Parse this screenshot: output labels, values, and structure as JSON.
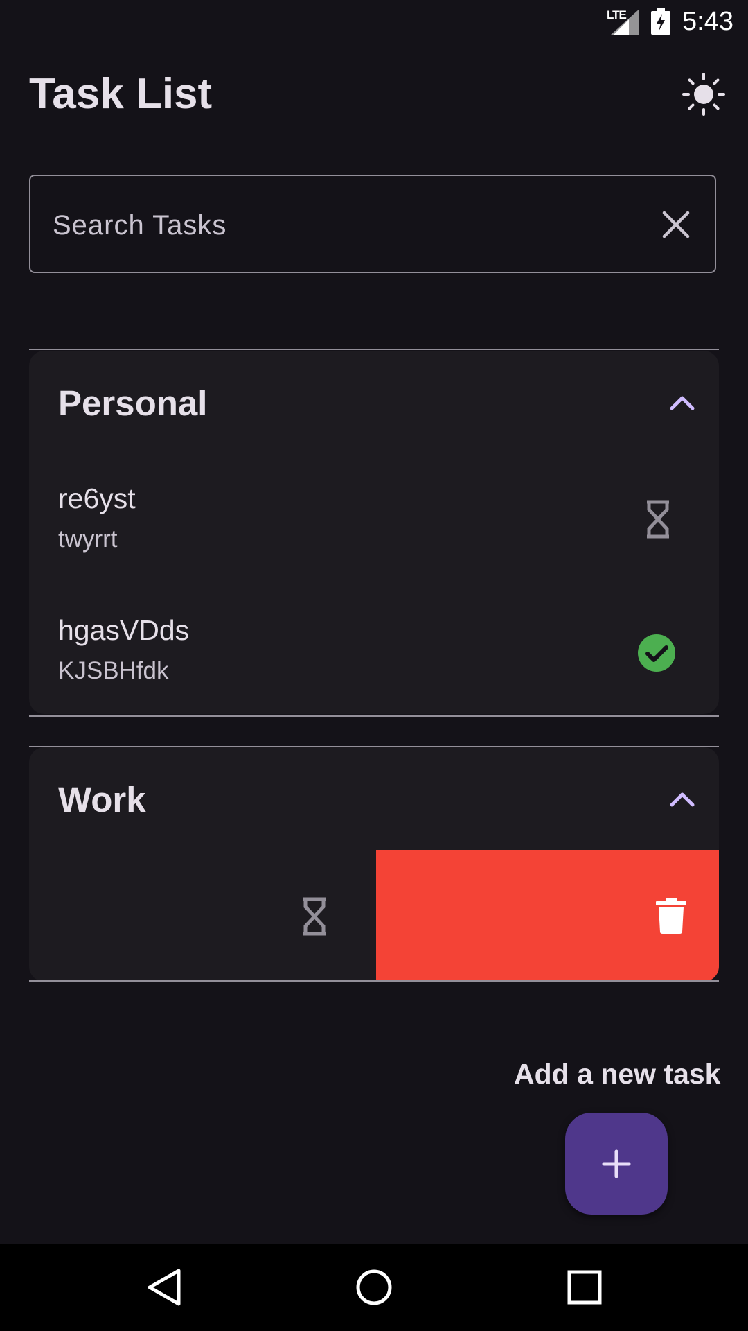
{
  "status_bar": {
    "network": "LTE",
    "time": "5:43",
    "icons": [
      "signal-icon",
      "battery-charging-icon"
    ]
  },
  "header": {
    "title": "Task List",
    "theme_icon": "sun-icon"
  },
  "search": {
    "placeholder": "Search Tasks",
    "value": "",
    "clear_icon": "close-icon"
  },
  "categories": [
    {
      "name": "Personal",
      "expanded": true,
      "tasks": [
        {
          "title": "re6yst",
          "description": "twyrrt",
          "status_icon": "hourglass-icon"
        },
        {
          "title": "hgasVDds",
          "description": "KJSBHfdk",
          "status_icon": "check-circle-icon"
        }
      ]
    },
    {
      "name": "Work",
      "expanded": true,
      "tasks": [
        {
          "title": "",
          "description": "",
          "status_icon": "hourglass-icon",
          "swipe_action_icon": "trash-icon"
        }
      ]
    }
  ],
  "fab": {
    "label": "Add a new task",
    "icon": "plus-icon"
  },
  "colors": {
    "background": "#141218",
    "card": "#1d1b20",
    "accent": "#d0bcff",
    "fab": "#4f378b",
    "delete": "#f44336",
    "done": "#4caf50"
  }
}
